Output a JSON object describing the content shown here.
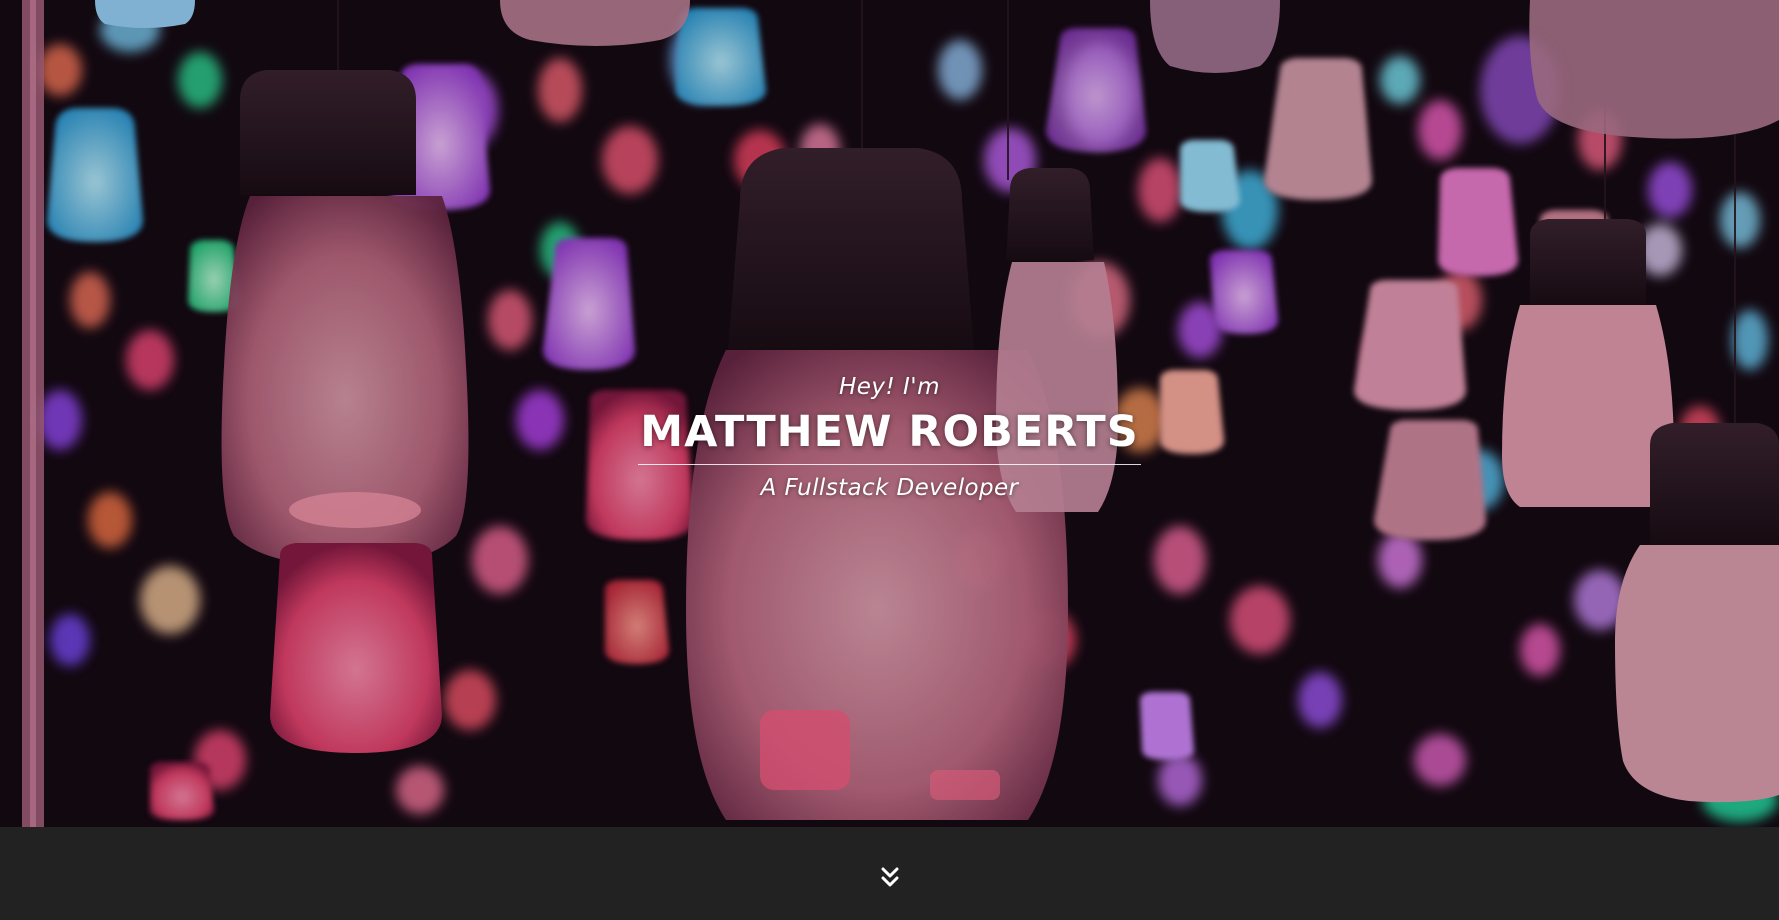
{
  "hero": {
    "greeting": "Hey! I'm",
    "name": "MATTHEW ROBERTS",
    "role": "A Fullstack Developer",
    "background_icon": "hanging-lanterns-photo"
  },
  "footer": {
    "scroll_icon": "double-chevron-down-icon",
    "background_color": "#222222",
    "icon_color": "#ffffff"
  }
}
